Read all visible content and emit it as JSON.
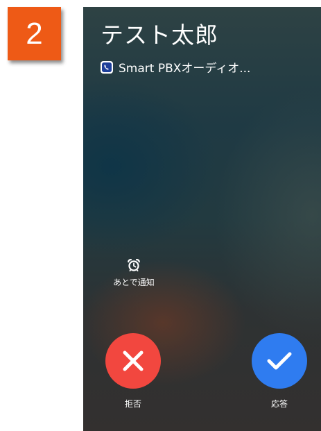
{
  "step": {
    "number": "2"
  },
  "incoming_call": {
    "caller_name": "テスト太郎",
    "app_name": "Smart PBXオーディオ...",
    "app_icon": "smart-pbx-app-icon"
  },
  "actions": {
    "remind_later": {
      "label": "あとで通知",
      "icon": "alarm-clock-icon"
    },
    "decline": {
      "label": "拒否",
      "icon": "close-icon",
      "color": "#f2473f"
    },
    "accept": {
      "label": "応答",
      "icon": "checkmark-icon",
      "color": "#2f7cf0"
    }
  },
  "colors": {
    "step_badge": "#ee5a16"
  }
}
